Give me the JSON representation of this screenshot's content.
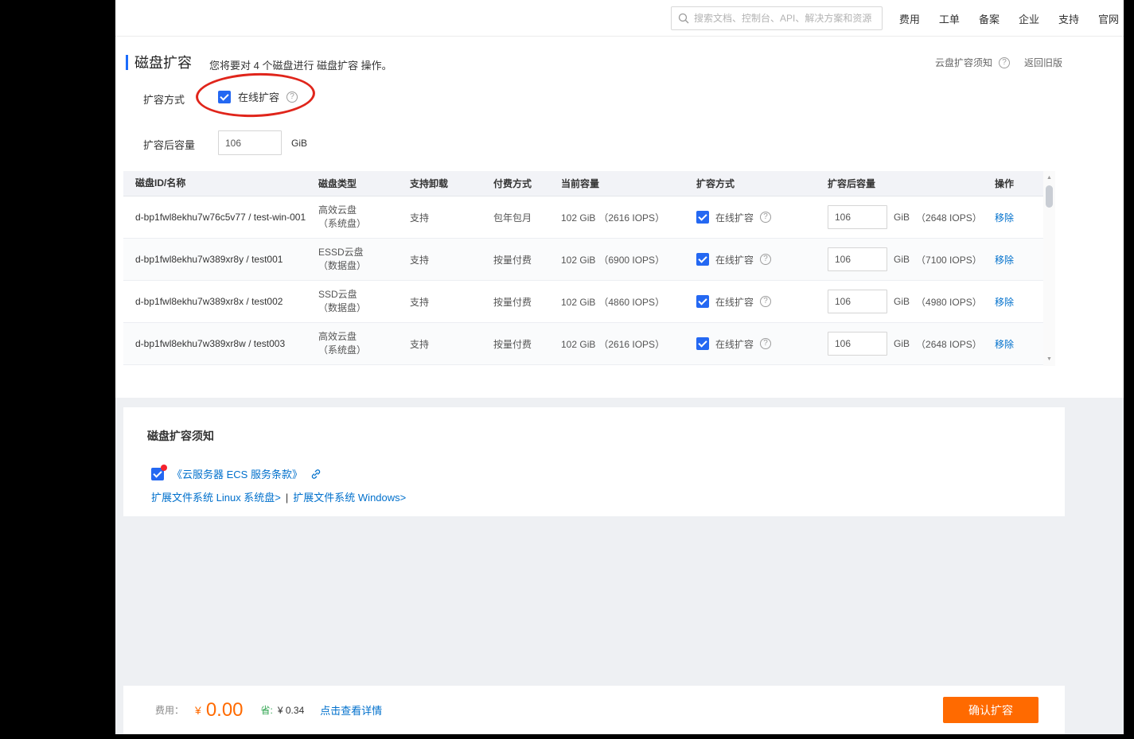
{
  "colors": {
    "accent_orange": "#FF6A00",
    "link_blue": "#0070CC",
    "checkbox_blue": "#2468F2",
    "annotation_red": "#E0251B",
    "save_green": "#2EA44F"
  },
  "icons": {
    "help_glyph": "?",
    "arrow_up": "▲",
    "arrow_down": "▼",
    "separator": "|"
  },
  "topbar": {
    "search_placeholder": "搜索文档、控制台、API、解决方案和资源",
    "nav_items": [
      "费用",
      "工单",
      "备案",
      "企业",
      "支持",
      "官网"
    ]
  },
  "page_header": {
    "title": "磁盘扩容",
    "subtitle": "您将要对 4 个磁盘进行 磁盘扩容 操作。",
    "notice_link": "云盘扩容须知",
    "back_link": "返回旧版"
  },
  "form": {
    "method_label": "扩容方式",
    "method_option": "在线扩容",
    "capacity_label": "扩容后容量",
    "capacity_value": "106",
    "capacity_unit": "GiB"
  },
  "table": {
    "headers": [
      "磁盘ID/名称",
      "磁盘类型",
      "支持卸载",
      "付费方式",
      "当前容量",
      "扩容方式",
      "扩容后容量",
      "操作"
    ],
    "rows": [
      {
        "disk_id": "d-bp1fwl8ekhu7w76c5v77 / test-win-001",
        "disk_type": "高效云盘",
        "disk_role": "（系统盘）",
        "detachable": "支持",
        "billing": "包年包月",
        "current_capacity": "102 GiB",
        "current_iops": "（2616 IOPS）",
        "expand_method": "在线扩容",
        "new_capacity": "106",
        "new_unit": "GiB",
        "new_iops": "（2648 IOPS）",
        "action": "移除"
      },
      {
        "disk_id": "d-bp1fwl8ekhu7w389xr8y / test001",
        "disk_type": "ESSD云盘",
        "disk_role": "（数据盘）",
        "detachable": "支持",
        "billing": "按量付费",
        "current_capacity": "102 GiB",
        "current_iops": "（6900 IOPS）",
        "expand_method": "在线扩容",
        "new_capacity": "106",
        "new_unit": "GiB",
        "new_iops": "（7100 IOPS）",
        "action": "移除"
      },
      {
        "disk_id": "d-bp1fwl8ekhu7w389xr8x / test002",
        "disk_type": "SSD云盘",
        "disk_role": "（数据盘）",
        "detachable": "支持",
        "billing": "按量付费",
        "current_capacity": "102 GiB",
        "current_iops": "（4860 IOPS）",
        "expand_method": "在线扩容",
        "new_capacity": "106",
        "new_unit": "GiB",
        "new_iops": "（4980 IOPS）",
        "action": "移除"
      },
      {
        "disk_id": "d-bp1fwl8ekhu7w389xr8w / test003",
        "disk_type": "高效云盘",
        "disk_role": "（系统盘）",
        "detachable": "支持",
        "billing": "按量付费",
        "current_capacity": "102 GiB",
        "current_iops": "（2616 IOPS）",
        "expand_method": "在线扩容",
        "new_capacity": "106",
        "new_unit": "GiB",
        "new_iops": "（2648 IOPS）",
        "action": "移除"
      }
    ]
  },
  "notice_card": {
    "title": "磁盘扩容须知",
    "terms_link": "《云服务器 ECS 服务条款》",
    "fs_link_linux": "扩展文件系统 Linux 系统盘>",
    "fs_link_windows": "扩展文件系统 Windows>"
  },
  "fee_bar": {
    "fee_label": "费用：",
    "currency_symbol": "¥",
    "fee_amount": "0.00",
    "save_label": "省:",
    "save_amount": "¥ 0.34",
    "detail_link": "点击查看详情",
    "confirm_button": "确认扩容"
  }
}
